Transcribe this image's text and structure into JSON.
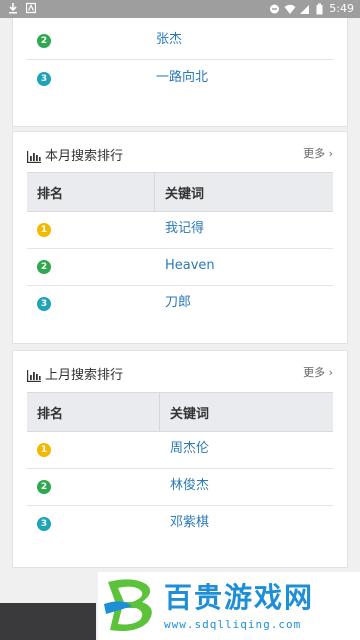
{
  "status_bar": {
    "time": "5:49",
    "left_icons": [
      "download-icon",
      "notification-icon"
    ],
    "right_icons": [
      "minus-circle-icon",
      "wifi-icon",
      "signal-icon",
      "battery-icon"
    ]
  },
  "colors": {
    "badge_gold": "#f5b800",
    "badge_green": "#2fa84f",
    "badge_teal": "#1fa3b8",
    "link_blue": "#2a7ab8"
  },
  "top_card": {
    "rows": [
      {
        "rank": "2",
        "keyword": "张杰"
      },
      {
        "rank": "3",
        "keyword": "一路向北"
      }
    ]
  },
  "month_card": {
    "title": "本月搜索排行",
    "more": "更多",
    "header_rank": "排名",
    "header_keyword": "关键词",
    "rows": [
      {
        "rank": "1",
        "keyword": "我记得"
      },
      {
        "rank": "2",
        "keyword": "Heaven"
      },
      {
        "rank": "3",
        "keyword": "刀郎"
      }
    ]
  },
  "last_month_card": {
    "title": "上月搜索排行",
    "more": "更多",
    "header_rank": "排名",
    "header_keyword": "关键词",
    "rows": [
      {
        "rank": "1",
        "keyword": "周杰伦"
      },
      {
        "rank": "2",
        "keyword": "林俊杰"
      },
      {
        "rank": "3",
        "keyword": "邓紫棋"
      }
    ]
  },
  "watermark": {
    "title": "百贵游戏网",
    "url": "www.sdqlliqing.com"
  }
}
